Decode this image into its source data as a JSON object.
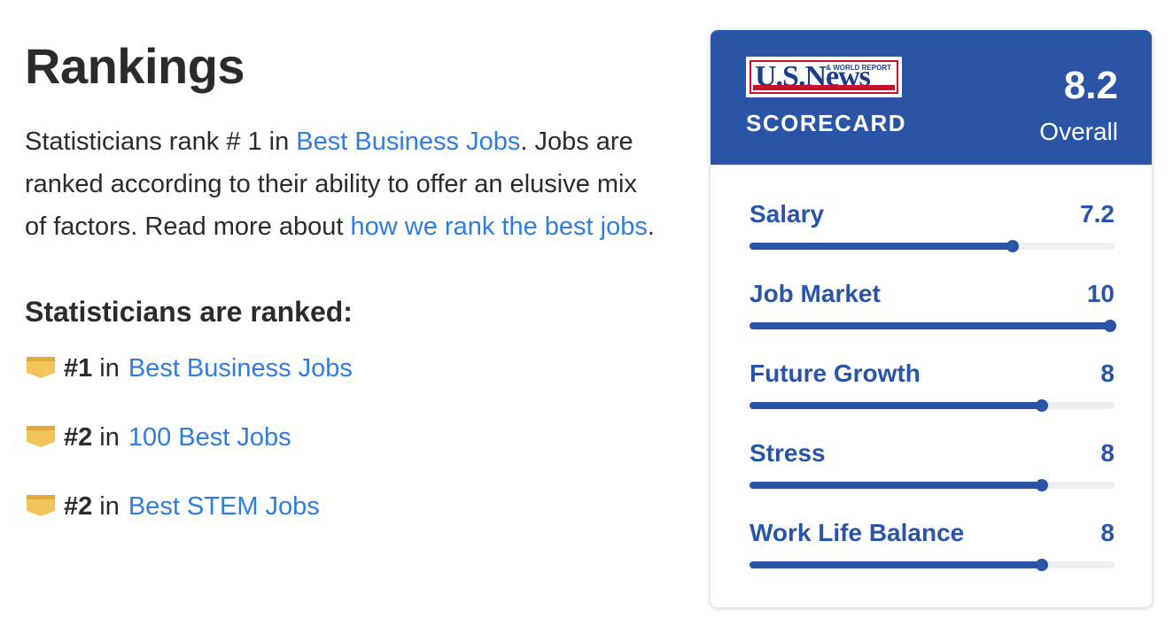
{
  "rankings": {
    "title": "Rankings",
    "intro": {
      "part1": "Statisticians rank # 1 in ",
      "link1": "Best Business Jobs",
      "part2": ". Jobs are ranked according to their ability to offer an elusive mix of factors. Read more about ",
      "link2": "how we rank the best jobs",
      "part3": "."
    },
    "ranked_heading": "Statisticians are ranked:",
    "items": [
      {
        "rank": "#1",
        "in": "in",
        "label": "Best Business Jobs",
        "icon": "ribbon-icon"
      },
      {
        "rank": "#2",
        "in": "in",
        "label": "100 Best Jobs",
        "icon": "ribbon-icon"
      },
      {
        "rank": "#2",
        "in": "in",
        "label": "Best STEM Jobs",
        "icon": "ribbon-icon"
      }
    ]
  },
  "scorecard": {
    "logo_text": "U.S.News",
    "logo_small": "& WORLD REPORT",
    "label": "SCORECARD",
    "overall_score": "8.2",
    "overall_label": "Overall",
    "max_score": 10,
    "metrics": [
      {
        "label": "Salary",
        "value": "7.2",
        "score": 7.2
      },
      {
        "label": "Job Market",
        "value": "10",
        "score": 10
      },
      {
        "label": "Future Growth",
        "value": "8",
        "score": 8
      },
      {
        "label": "Stress",
        "value": "8",
        "score": 8
      },
      {
        "label": "Work Life Balance",
        "value": "8",
        "score": 8
      }
    ]
  },
  "colors": {
    "brand_blue": "#2a55a7",
    "link_blue": "#2f7de1",
    "ribbon_gold": "#f2c45a",
    "logo_red": "#c8102e"
  }
}
